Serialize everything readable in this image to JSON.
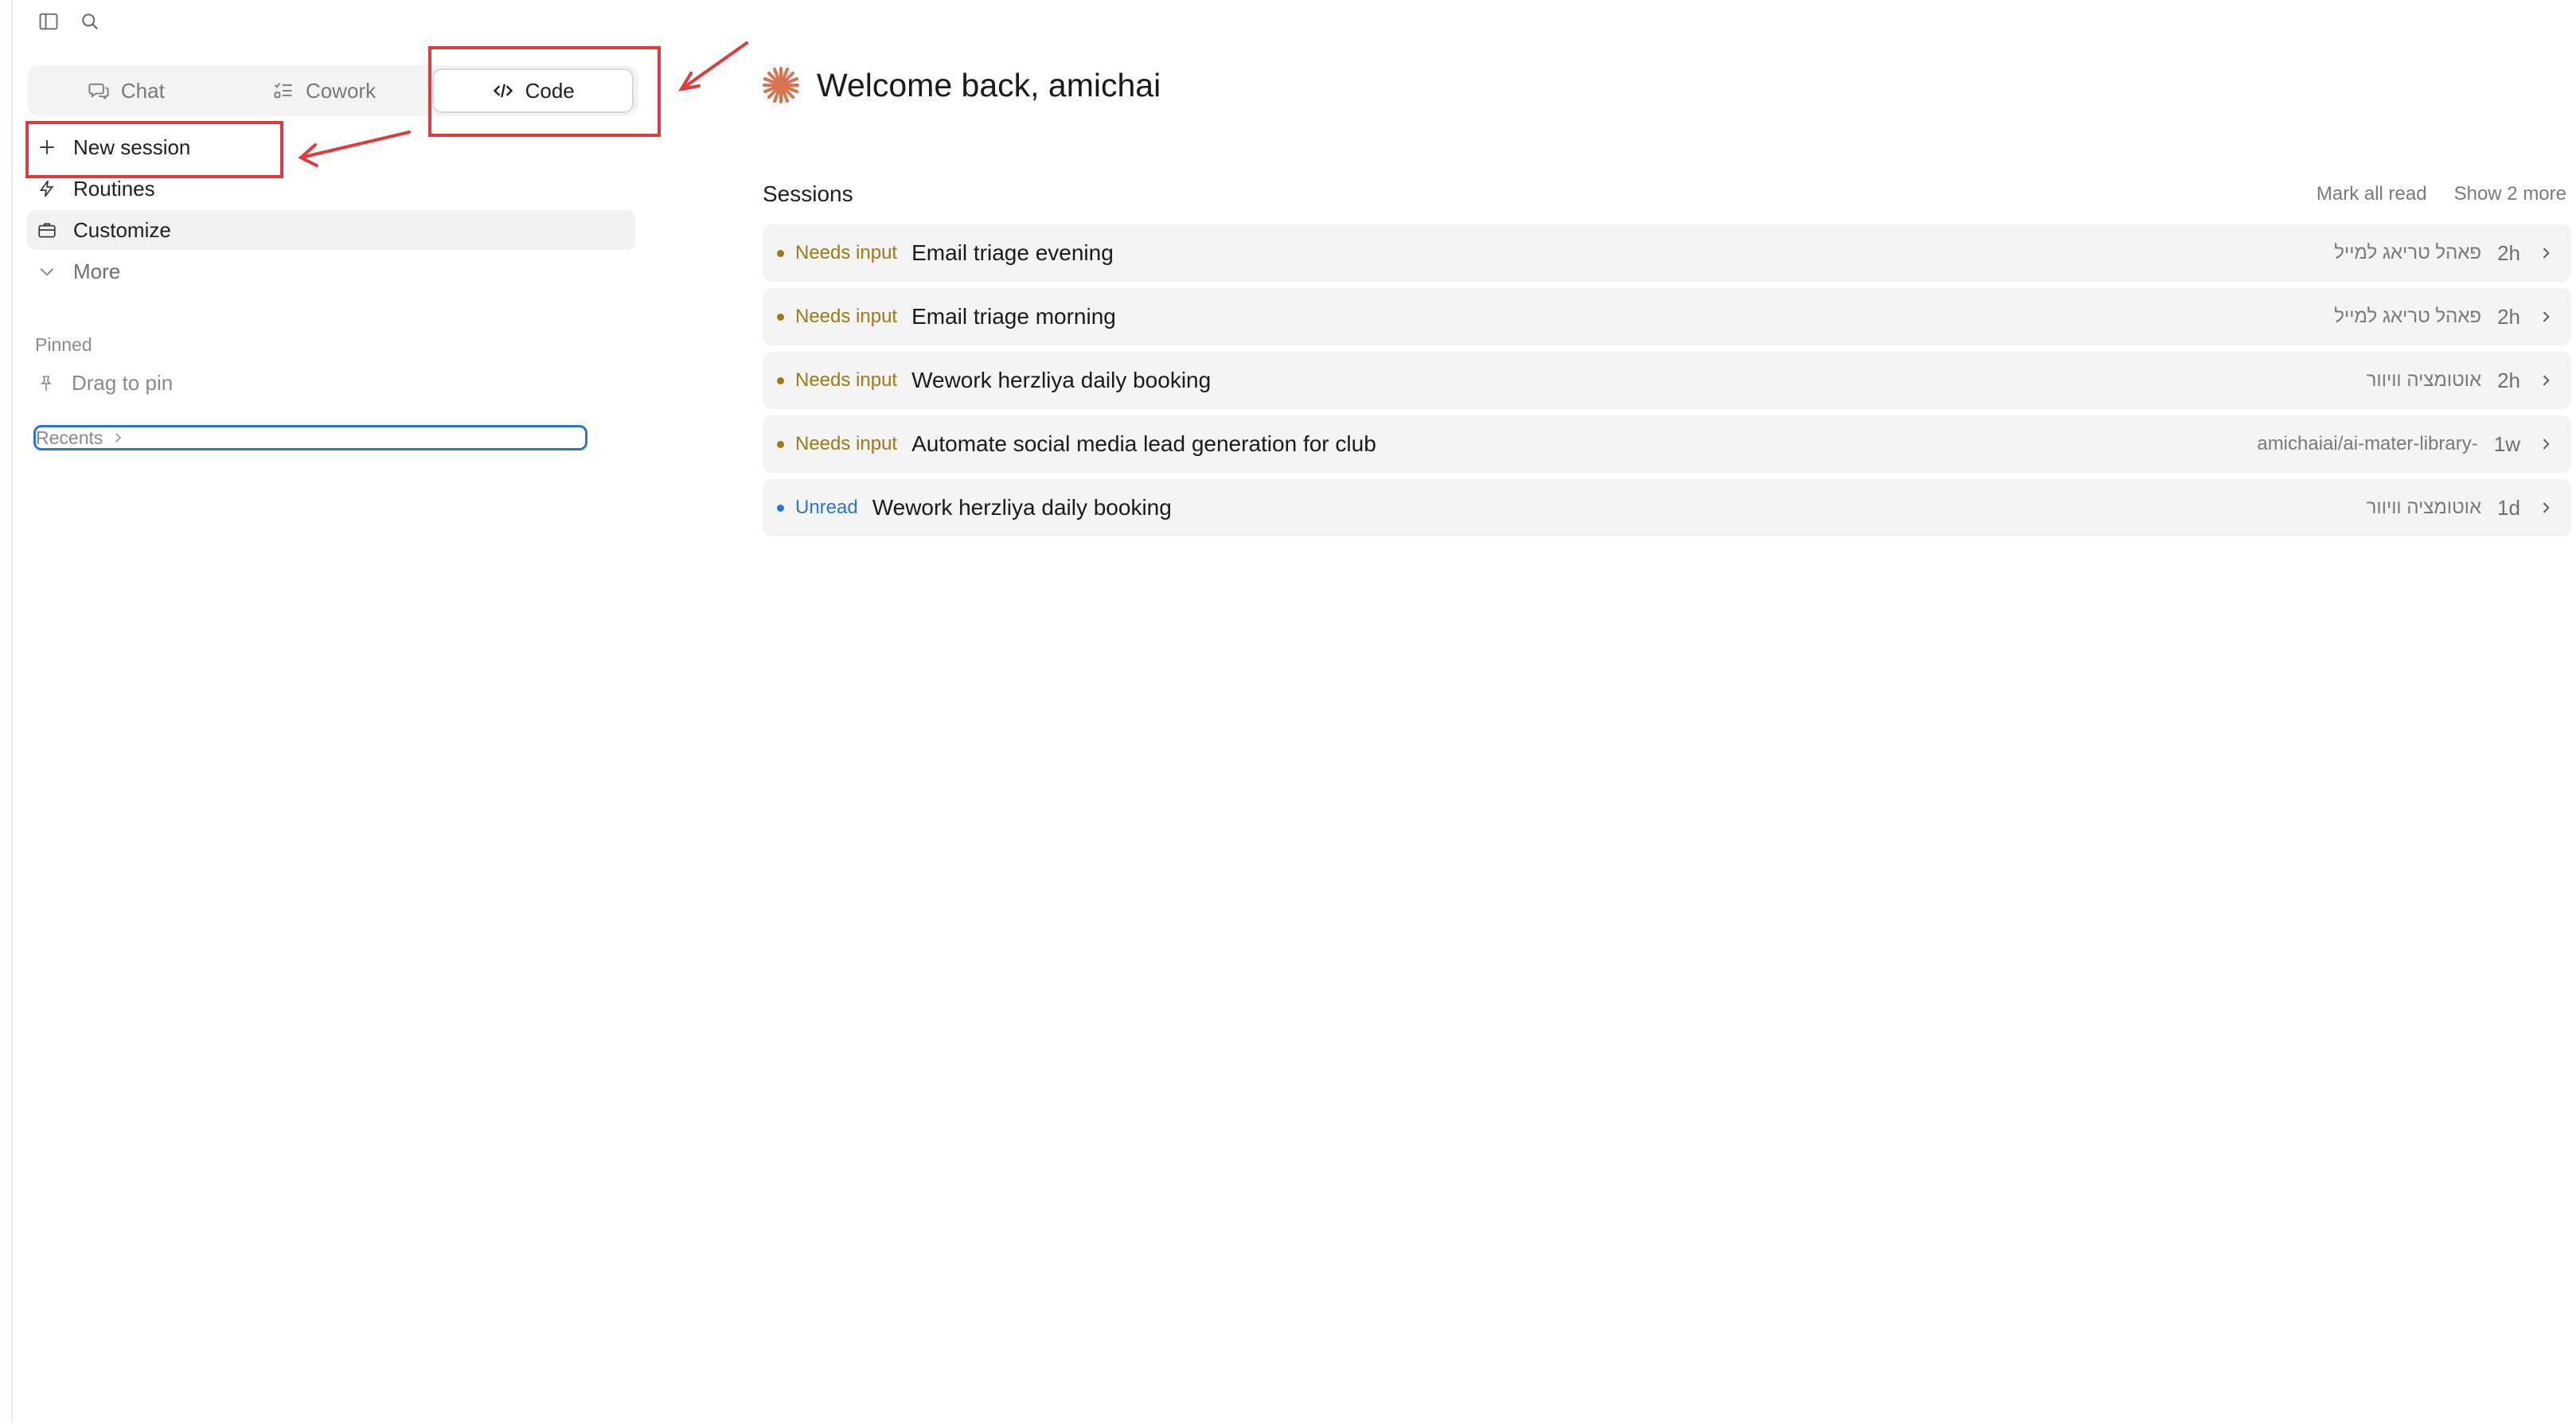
{
  "colors": {
    "accent_red": "#e03b3b",
    "needs_input": "#9a7a19",
    "unread": "#2f74d0",
    "logo": "#d8734f"
  },
  "topbar": {
    "icons": [
      "sidebar-toggle-icon",
      "search-icon"
    ]
  },
  "modes": {
    "tabs": [
      {
        "label": "Chat",
        "icon": "chat-icon",
        "active": false
      },
      {
        "label": "Cowork",
        "icon": "checklist-icon",
        "active": false
      },
      {
        "label": "Code",
        "icon": "code-icon",
        "active": true
      }
    ]
  },
  "sidebar": {
    "items": [
      {
        "label": "New session",
        "icon": "plus-icon"
      },
      {
        "label": "Routines",
        "icon": "bolt-icon"
      },
      {
        "label": "Customize",
        "icon": "briefcase-icon"
      },
      {
        "label": "More",
        "icon": "chevron-down-icon"
      }
    ],
    "pinned_label": "Pinned",
    "pin_hint": "Drag to pin",
    "recents_label": "Recents"
  },
  "main": {
    "welcome": "Welcome back, amichai",
    "sessions_title": "Sessions",
    "mark_all_read": "Mark all read",
    "show_more": "Show 2 more",
    "sessions": [
      {
        "status": "Needs input",
        "status_type": "needs_input",
        "title": "Email triage evening",
        "meta": "פאהל טריאג למייל",
        "age": "2h"
      },
      {
        "status": "Needs input",
        "status_type": "needs_input",
        "title": "Email triage morning",
        "meta": "פאהל טריאג למייל",
        "age": "2h"
      },
      {
        "status": "Needs input",
        "status_type": "needs_input",
        "title": "Wework herzliya daily booking",
        "meta": "אוטומציה וויוור",
        "age": "2h"
      },
      {
        "status": "Needs input",
        "status_type": "needs_input",
        "title": "Automate social media lead generation for club",
        "meta": "amichaiai/ai-mater-library-",
        "age": "1w"
      },
      {
        "status": "Unread",
        "status_type": "unread",
        "title": "Wework herzliya daily booking",
        "meta": "אוטומציה וויוור",
        "age": "1d"
      }
    ]
  }
}
